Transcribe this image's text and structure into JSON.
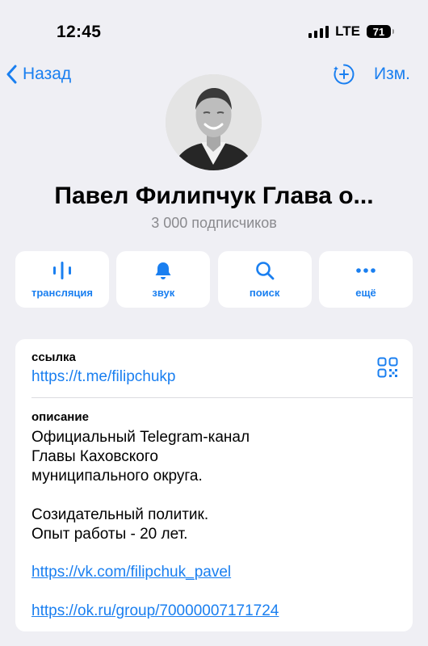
{
  "status_bar": {
    "time": "12:45",
    "network": "LTE",
    "battery": "71"
  },
  "nav": {
    "back_label": "Назад",
    "edit_label": "Изм."
  },
  "profile": {
    "name": "Павел Филипчук Глава о...",
    "subscribers": "3 000 подписчиков"
  },
  "actions": [
    {
      "label": "трансляция",
      "icon": "broadcast-icon"
    },
    {
      "label": "звук",
      "icon": "bell-icon"
    },
    {
      "label": "поиск",
      "icon": "search-icon"
    },
    {
      "label": "ещё",
      "icon": "more-icon"
    }
  ],
  "info": {
    "link_label": "ссылка",
    "link_value": "https://t.me/filipchukp",
    "description_label": "описание",
    "description_lines": [
      "Официальный Telegram-канал",
      "Главы Каховского",
      "муниципального округа."
    ],
    "description_lines_2": [
      "Созидательный политик.",
      "Опыт работы - 20 лет."
    ],
    "url_1": "https://vk.com/filipchuk_pavel",
    "url_2": "https://ok.ru/group/70000007171724"
  },
  "colors": {
    "accent": "#1a7ff0",
    "background": "#efeff4",
    "secondary_text": "#8a8a8e"
  }
}
